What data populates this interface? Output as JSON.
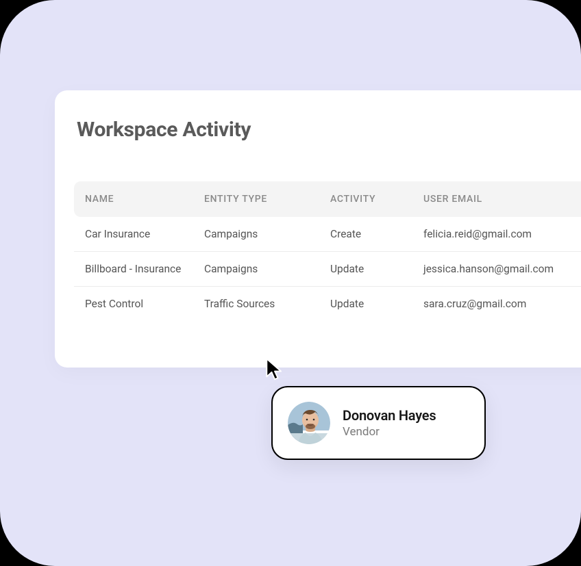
{
  "page": {
    "title": "Workspace Activity"
  },
  "table": {
    "headers": {
      "name": "NAME",
      "entity_type": "ENTITY TYPE",
      "activity": "ACTIVITY",
      "user_email": "USER EMAIL"
    },
    "rows": [
      {
        "name": "Car Insurance",
        "entity_type": "Campaigns",
        "activity": "Create",
        "user_email": "felicia.reid@gmail.com"
      },
      {
        "name": "Billboard - Insurance",
        "entity_type": "Campaigns",
        "activity": "Update",
        "user_email": "jessica.hanson@gmail.com"
      },
      {
        "name": "Pest Control",
        "entity_type": "Traffic Sources",
        "activity": "Update",
        "user_email": "sara.cruz@gmail.com"
      }
    ]
  },
  "profile": {
    "name": "Donovan Hayes",
    "role": "Vendor"
  }
}
